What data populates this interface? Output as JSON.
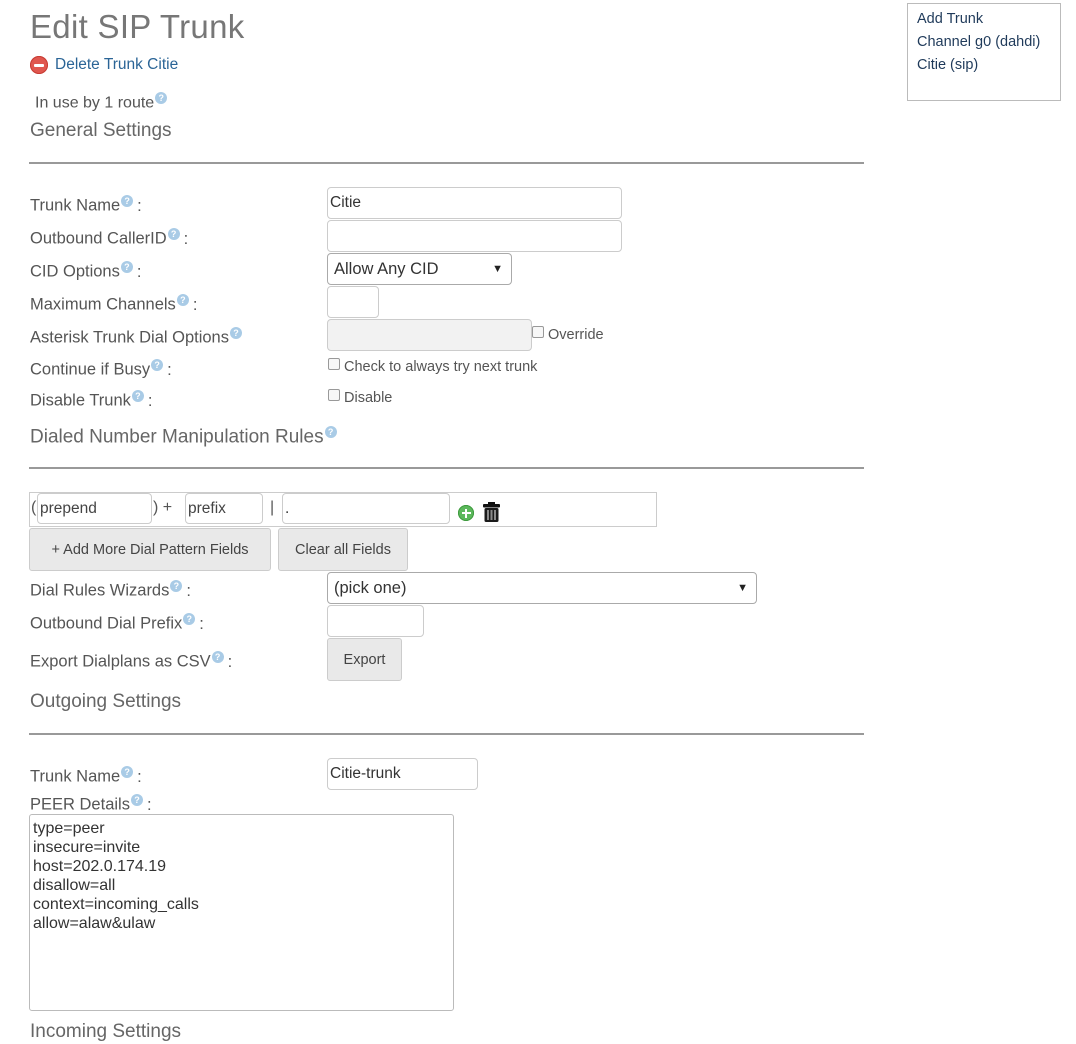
{
  "page": {
    "title": "Edit SIP Trunk",
    "delete_link": "Delete Trunk Citie",
    "in_use": "In use by 1 route"
  },
  "sections": {
    "general": "General Settings",
    "dial_rules": "Dialed Number Manipulation Rules",
    "outgoing": "Outgoing Settings",
    "incoming": "Incoming Settings"
  },
  "general": {
    "trunk_name_label": "Trunk Name",
    "trunk_name_value": "Citie",
    "outbound_cid_label": "Outbound CallerID",
    "outbound_cid_value": "",
    "cid_options_label": "CID Options",
    "cid_options_value": "Allow Any CID",
    "max_channels_label": "Maximum Channels",
    "max_channels_value": "",
    "dial_options_label": "Asterisk Trunk Dial Options",
    "dial_options_value": "",
    "override_label": "Override",
    "continue_busy_label": "Continue if Busy",
    "continue_busy_cb_label": "Check to always try next trunk",
    "disable_trunk_label": "Disable Trunk",
    "disable_cb_label": "Disable"
  },
  "dial_rules": {
    "open_paren": "(",
    "prepend_placeholder": "prepend",
    "close_plus": ") +",
    "prefix_placeholder": "prefix",
    "pipe": "|",
    "pattern_value": ".",
    "add_more_button": "+ Add More Dial Pattern Fields",
    "clear_button": "Clear all Fields",
    "wizards_label": "Dial Rules Wizards",
    "wizards_value": "(pick one)",
    "outbound_prefix_label": "Outbound Dial Prefix",
    "outbound_prefix_value": "",
    "export_label": "Export Dialplans as CSV",
    "export_button": "Export"
  },
  "outgoing": {
    "trunk_name_label": "Trunk Name",
    "trunk_name_value": "Citie-trunk",
    "peer_details_label": "PEER Details",
    "peer_details_value": "type=peer\ninsecure=invite\nhost=202.0.174.19\ndisallow=all\ncontext=incoming_calls\nallow=alaw&ulaw"
  },
  "sidebar": {
    "items": [
      "Add Trunk",
      "Channel g0 (dahdi)",
      "Citie (sip)"
    ]
  },
  "icons": {
    "help": "help-icon",
    "delete": "delete-icon",
    "add": "add-pattern-icon",
    "trash": "trash-icon"
  },
  "colors": {
    "link": "#2a6496",
    "delete_icon": "#e0574f",
    "add_icon": "#5cb85c",
    "help_icon": "#a9cbe6"
  }
}
